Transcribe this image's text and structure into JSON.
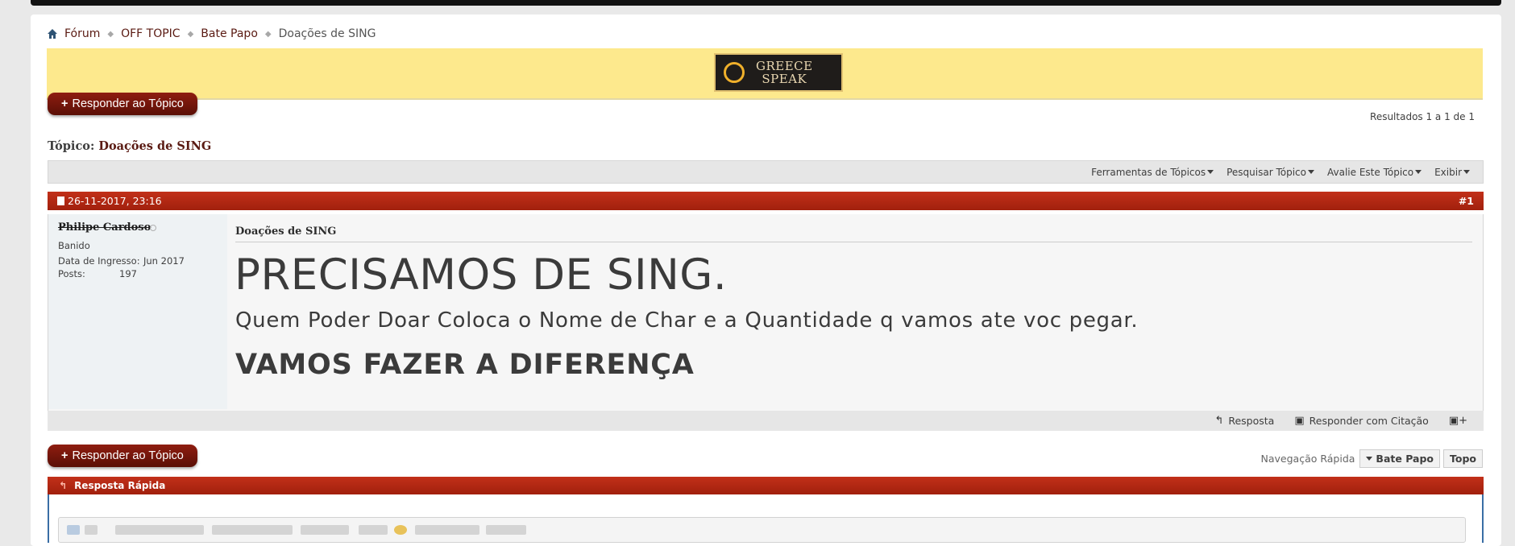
{
  "breadcrumb": {
    "items": [
      "Fórum",
      "OFF TOPIC",
      "Bate Papo"
    ],
    "current": "Doações de SING"
  },
  "banner": {
    "logo_line1": "GREECE",
    "logo_line2": "SPEAK"
  },
  "reply_button_label": "Responder ao Tópico",
  "results": "Resultados 1 a 1 de 1",
  "thread": {
    "label": "Tópico:",
    "title": "Doações de SING"
  },
  "tools": [
    "Ferramentas de Tópicos",
    "Pesquisar Tópico",
    "Avalie Este Tópico",
    "Exibir"
  ],
  "post": {
    "date": "26-11-2017, 23:16",
    "number": "#1",
    "username": "Philipe Cardoso",
    "user_title": "Banido",
    "join_label": "Data de Ingresso:",
    "join_value": "Jun 2017",
    "posts_label": "Posts:",
    "posts_value": "197",
    "title": "Doações de SING",
    "line1": "PRECISAMOS DE SING.",
    "line2": "Quem Poder Doar Coloca o Nome de Char e a Quantidade q vamos ate voc pegar.",
    "line3": "VAMOS FAZER A DIFERENÇA"
  },
  "post_actions": {
    "reply": "Resposta",
    "quote": "Responder com Citação"
  },
  "quick_nav": {
    "label": "Navegação Rápida",
    "forum_button": "Bate Papo",
    "top_button": "Topo"
  },
  "quick_reply": {
    "title": "Resposta Rápida"
  },
  "colors": {
    "header_red": "#b22713",
    "banner_yellow": "#fde98d",
    "button_dark_red": "#6b140a",
    "link_brown": "#5a1a12"
  }
}
